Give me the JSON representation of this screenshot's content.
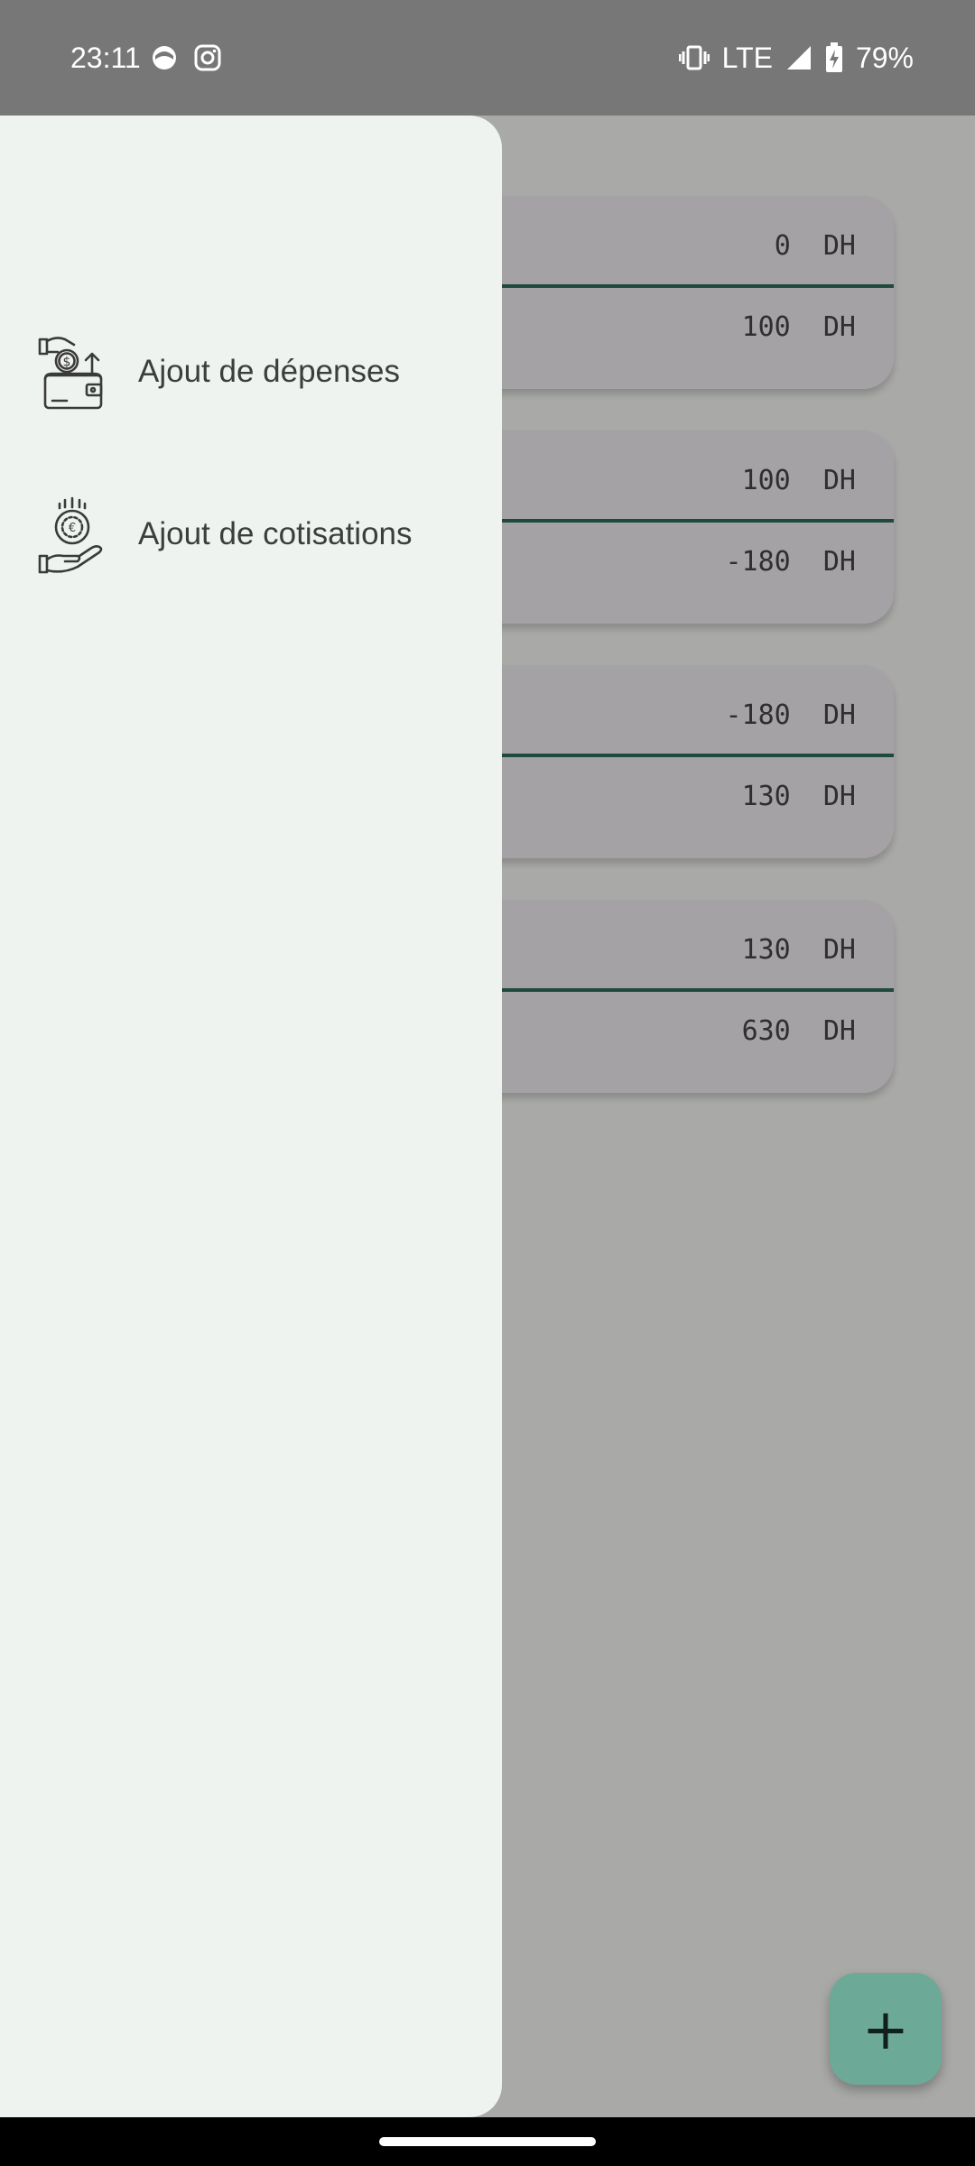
{
  "status_bar": {
    "time": "23:11",
    "network": "LTE",
    "battery": "79%",
    "icons": [
      "notification-icon",
      "instagram-icon",
      "vibrate-icon",
      "signal-icon",
      "battery-charging-icon"
    ]
  },
  "drawer": {
    "items": [
      {
        "label": "Ajout de dépenses",
        "icon": "wallet-expense-icon"
      },
      {
        "label": "Ajout de cotisations",
        "icon": "hand-coin-icon"
      }
    ]
  },
  "cards": [
    {
      "top_value": "0  DH",
      "bottom_value": "100  DH"
    },
    {
      "top_value": "100  DH",
      "bottom_value": "-180  DH"
    },
    {
      "top_value": "-180  DH",
      "bottom_value": "130  DH"
    },
    {
      "top_value": "130  DH",
      "bottom_value": "630  DH"
    }
  ],
  "fab": {
    "label": "+",
    "icon": "add-icon"
  },
  "colors": {
    "drawer_bg": "#eef3ef",
    "scrim_bg": "#a9aaa8",
    "card_divider": "#1f4a3c",
    "fab_bg": "#6ca997"
  }
}
